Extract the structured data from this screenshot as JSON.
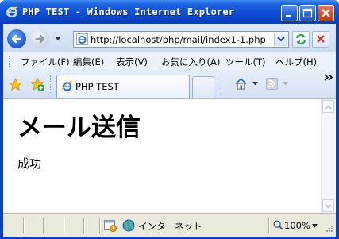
{
  "window": {
    "title": "PHP TEST - Windows Internet Explorer"
  },
  "navigation": {
    "address": "http://localhost/php/mail/index1-1.php"
  },
  "menu": {
    "items": [
      "ファイル(F)",
      "編集(E)",
      "表示(V)",
      "お気に入り(A)",
      "ツール(T)",
      "ヘルプ(H)"
    ]
  },
  "tabs": {
    "active_label": "PHP TEST"
  },
  "page": {
    "heading": "メール送信",
    "body": "成功"
  },
  "status": {
    "zone": "インターネット",
    "zoom": "100%"
  },
  "colors": {
    "titlebar": "#0b46c7",
    "close_button": "#d3502b"
  }
}
